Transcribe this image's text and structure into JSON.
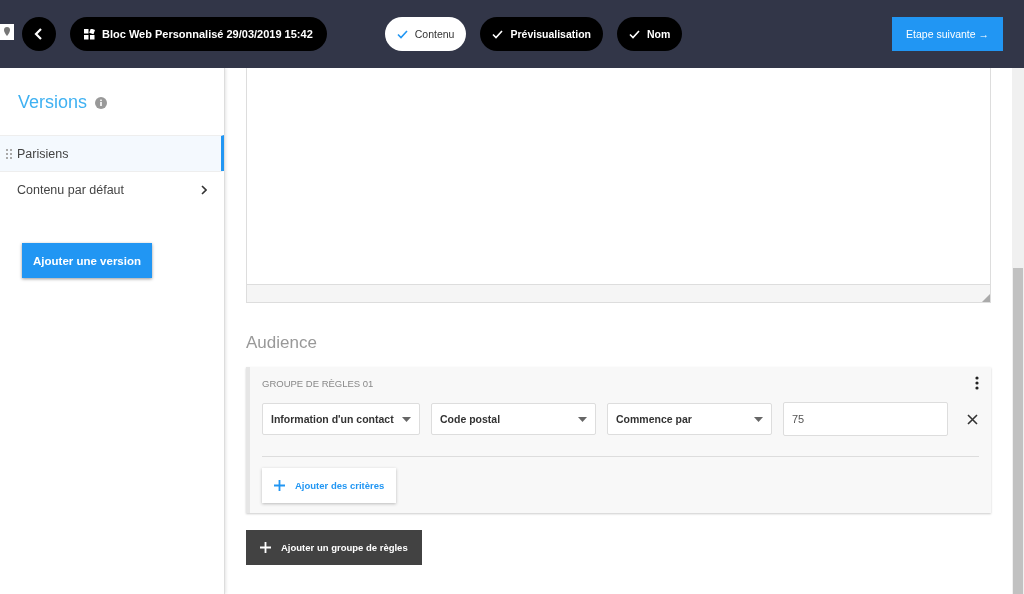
{
  "header": {
    "title": "Bloc Web Personnalisé 29/03/2019 15:42",
    "steps": [
      {
        "label": "Contenu",
        "selected": true
      },
      {
        "label": "Prévisualisation",
        "selected": false
      },
      {
        "label": "Nom",
        "selected": false
      }
    ],
    "next_button": "Etape suivante →"
  },
  "sidebar": {
    "title": "Versions",
    "items": [
      {
        "label": "Parisiens",
        "selected": true,
        "kind": "draggable"
      },
      {
        "label": "Contenu par défaut",
        "selected": false,
        "kind": "submenu"
      }
    ],
    "add_button": "Ajouter une version"
  },
  "audience": {
    "title": "Audience",
    "groups": [
      {
        "title": "GROUPE DE RÈGLES 01",
        "rules": [
          {
            "field_1": "Information d'un contact",
            "field_2": "Code postal",
            "operator": "Commence par",
            "value": "75"
          }
        ],
        "add_criteria": "Ajouter des critères"
      }
    ],
    "add_group": "Ajouter un groupe de règles"
  }
}
